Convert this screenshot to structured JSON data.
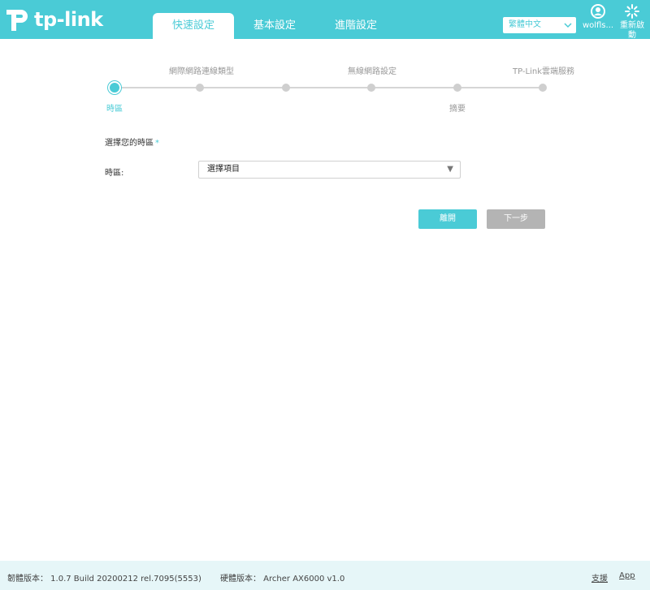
{
  "header": {
    "brand": "tp-link",
    "tabs": [
      {
        "label": "快速設定",
        "active": true
      },
      {
        "label": "基本設定",
        "active": false
      },
      {
        "label": "進階設定",
        "active": false
      }
    ],
    "language": "繁體中文",
    "account_label": "wolfls...",
    "reboot_label": "重新啟動"
  },
  "stepper": {
    "top_labels": [
      "網際網路連線類型",
      "無線網路設定",
      "TP-Link雲端服務"
    ],
    "bottom_labels": [
      "時區",
      "摘要"
    ],
    "active_step": 0
  },
  "form": {
    "section_title": "選擇您的時區",
    "required_mark": "*",
    "timezone_label": "時區:",
    "timezone_value": "選擇項目"
  },
  "buttons": {
    "exit": "離開",
    "next": "下一步"
  },
  "footer": {
    "firmware": "韌體版本： 1.0.7 Build 20200212 rel.7095(5553)",
    "hardware": "硬體版本： Archer AX6000 v1.0",
    "support": "支援",
    "app": "App"
  },
  "colors": {
    "accent": "#4acbd6",
    "header_bg": "#4acbd6",
    "next_disabled": "#b4b4b4",
    "footer_bg": "#e6f6f8"
  }
}
